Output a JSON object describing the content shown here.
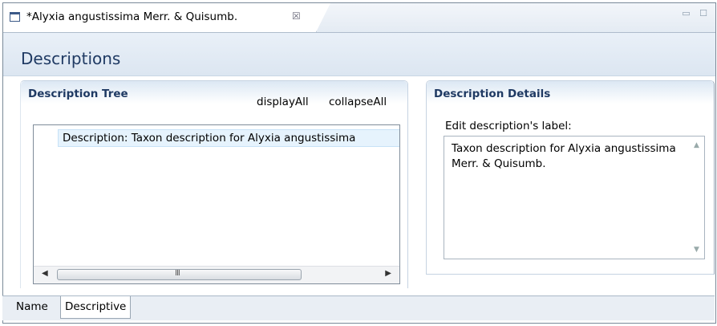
{
  "editor_tab": {
    "title": "*Alyxia angustissima Merr. & Quisumb.",
    "close_glyph": "☒",
    "icon": "editor-window-icon"
  },
  "window_controls": {
    "minimize": "▭",
    "maximize": "☐"
  },
  "form": {
    "title": "Descriptions"
  },
  "tree_section": {
    "title": "Description Tree",
    "display_all": "displayAll",
    "collapse_all": "collapseAll",
    "item": "Description: Taxon description for Alyxia angustissima",
    "scroll_grip": "III"
  },
  "details_section": {
    "title": "Description Details",
    "field_label": "Edit description's label:",
    "field_value": "Taxon description for Alyxia angustissima Merr. & Quisumb."
  },
  "bottom_tabs": [
    {
      "label": "Name"
    },
    {
      "label": "Descriptive",
      "active": true
    }
  ]
}
